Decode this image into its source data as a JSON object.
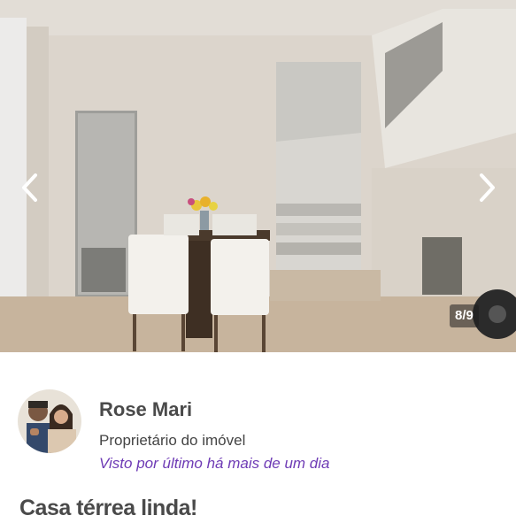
{
  "gallery": {
    "counter": "8/9",
    "current_index": 8,
    "total": 9,
    "prev_icon": "chevron-left-icon",
    "next_icon": "chevron-right-icon"
  },
  "owner": {
    "name": "Rose Mari",
    "role": "Proprietário do imóvel",
    "last_seen": "Visto por último há mais de um dia",
    "last_seen_color": "#6e3bb5"
  },
  "listing": {
    "title": "Casa térrea linda!"
  }
}
